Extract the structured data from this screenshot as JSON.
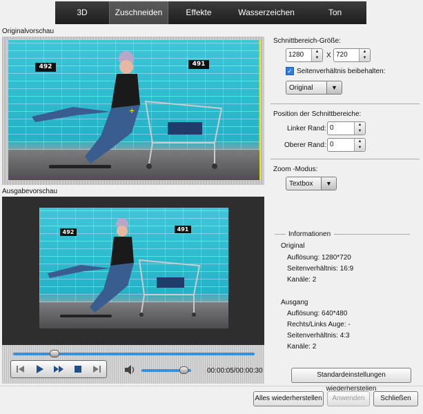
{
  "tabs": [
    {
      "label": "3D",
      "active": false
    },
    {
      "label": "Zuschneiden",
      "active": true
    },
    {
      "label": "Effekte",
      "active": false
    },
    {
      "label": "Wasserzeichen",
      "active": false
    },
    {
      "label": "Ton",
      "active": false
    }
  ],
  "original_preview": {
    "label": "Originalvorschau",
    "badge_left": "492",
    "badge_right": "491"
  },
  "output_preview": {
    "label": "Ausgabevorschau",
    "badge_left": "492",
    "badge_right": "491"
  },
  "player": {
    "seek_position_fraction": 0.17,
    "volume_fraction": 0.85,
    "time": "00:00:05/00:00:30",
    "controls": [
      "skip-back-icon",
      "play-icon",
      "fast-forward-icon",
      "stop-icon",
      "skip-forward-icon"
    ]
  },
  "crop": {
    "size_label": "Schnittbereich-Größe:",
    "width": "1280",
    "separator": "X",
    "height": "720",
    "keep_ratio_label": "Seitenverhältnis beibehalten:",
    "keep_ratio_checked": true,
    "ratio_value": "Original",
    "position_label": "Position der Schnittbereiche:",
    "left_margin_label": "Linker Rand:",
    "left_margin_value": "0",
    "top_margin_label": "Oberer Rand:",
    "top_margin_value": "0",
    "zoom_label": "Zoom -Modus:",
    "zoom_value": "Textbox"
  },
  "info": {
    "title": "Informationen",
    "original_heading": "Original",
    "original_resolution": "Auflösung: 1280*720",
    "original_ratio": "Seitenverhältnis: 16:9",
    "original_channels": "Kanäle: 2",
    "output_heading": "Ausgang",
    "output_resolution": "Auflösung: 640*480",
    "output_stereo": "Rechts/Links Auge: -",
    "output_ratio": "Seitenverhältnis: 4:3",
    "output_channels": "Kanäle: 2"
  },
  "buttons": {
    "restore_defaults": "Standardeinstellungen wiederherstellen",
    "restore_all": "Alles wiederherstellen",
    "apply": "Anwenden",
    "close": "Schließen"
  },
  "colors": {
    "accent": "#3b8fd6",
    "crop_frame": "#e6e600",
    "tab_bar": "#2b2b2b",
    "photo_wall": "#23b3c7"
  }
}
